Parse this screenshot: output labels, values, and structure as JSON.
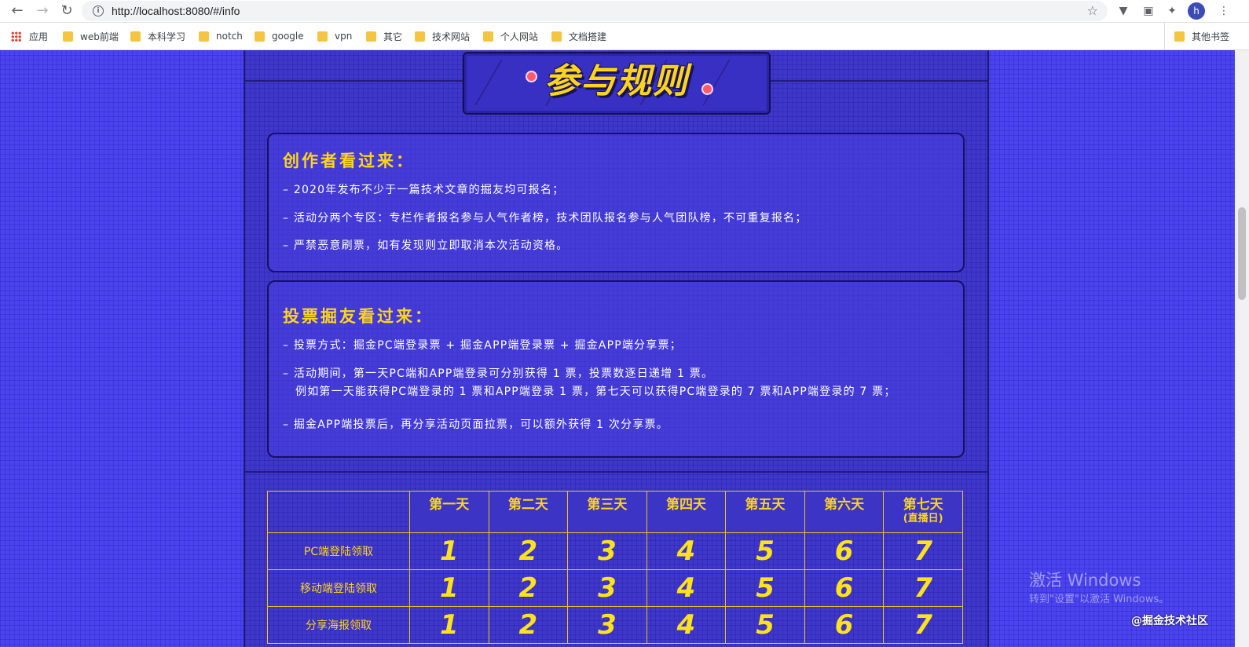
{
  "browser": {
    "url": "http://localhost:8080/#/info",
    "avatar_initial": "h",
    "bookmarks": [
      {
        "label": "应用",
        "icon": "apps-icon"
      },
      {
        "label": "web前端",
        "icon": "folder-icon"
      },
      {
        "label": "本科学习",
        "icon": "folder-icon"
      },
      {
        "label": "notch",
        "icon": "folder-icon"
      },
      {
        "label": "google",
        "icon": "folder-icon"
      },
      {
        "label": "vpn",
        "icon": "folder-icon"
      },
      {
        "label": "其它",
        "icon": "folder-icon"
      },
      {
        "label": "技术网站",
        "icon": "folder-icon"
      },
      {
        "label": "个人网站",
        "icon": "folder-icon"
      },
      {
        "label": "文档搭建",
        "icon": "folder-icon"
      }
    ],
    "other_bookmarks": "其他书签"
  },
  "page": {
    "title": "参与规则",
    "creator_section": {
      "heading": "创作者看过来：",
      "rules": [
        "– 2020年发布不少于一篇技术文章的掘友均可报名；",
        "– 活动分两个专区：专栏作者报名参与人气作者榜，技术团队报名参与人气团队榜，不可重复报名；",
        "– 严禁恶意刷票，如有发现则立即取消本次活动资格。"
      ]
    },
    "voter_section": {
      "heading": "投票掘友看过来：",
      "rules": [
        "– 投票方式：掘金PC端登录票 + 掘金APP端登录票 + 掘金APP端分享票；",
        "– 活动期间，第一天PC端和APP端登录可分别获得 1 票，投票数逐日递增 1 票。",
        "例如第一天能获得PC端登录的 1 票和APP端登录 1 票，第七天可以获得PC端登录的 7 票和APP端登录的 7 票；",
        "– 掘金APP端投票后，再分享活动页面拉票，可以额外获得 1 次分享票。"
      ]
    },
    "table": {
      "days": [
        "第一天",
        "第二天",
        "第三天",
        "第四天",
        "第五天",
        "第六天",
        "第七天"
      ],
      "day7_note": "(直播日)",
      "rows": [
        {
          "label": "PC端登陆领取",
          "values": [
            "1",
            "2",
            "3",
            "4",
            "5",
            "6",
            "7"
          ]
        },
        {
          "label": "移动端登陆领取",
          "values": [
            "1",
            "2",
            "3",
            "4",
            "5",
            "6",
            "7"
          ]
        },
        {
          "label": "分享海报领取",
          "values": [
            "1",
            "2",
            "3",
            "4",
            "5",
            "6",
            "7"
          ]
        }
      ]
    }
  },
  "overlay": {
    "activate_title": "激活 Windows",
    "activate_sub": "转到\"设置\"以激活 Windows。",
    "credit": "@掘金技术社区"
  },
  "colors": {
    "page_bg": "#4b43ee",
    "accent_yellow": "#ffd51c",
    "border_dark": "#16125e"
  }
}
